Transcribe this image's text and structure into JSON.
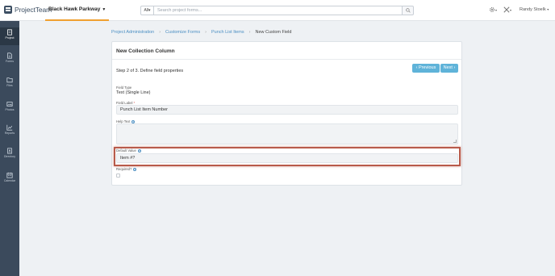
{
  "app": {
    "logo_text": "ProjectTeam",
    "project_name": "Black Hawk Parkway"
  },
  "search": {
    "filter_label": "All",
    "placeholder": "Search project forms..."
  },
  "user": {
    "name": "Randy Stoelk"
  },
  "sidebar": {
    "items": [
      {
        "label": "Project",
        "icon": "building-icon",
        "active": true
      },
      {
        "label": "Forms",
        "icon": "document-icon"
      },
      {
        "label": "Files",
        "icon": "folder-icon"
      },
      {
        "label": "Photos",
        "icon": "image-icon"
      },
      {
        "label": "Reports",
        "icon": "chart-icon"
      },
      {
        "label": "Directory",
        "icon": "contacts-icon"
      },
      {
        "label": "Calendar",
        "icon": "calendar-icon"
      }
    ]
  },
  "breadcrumb": [
    "Project Administration",
    "Customize Forms",
    "Punch List Items",
    "New Custom Field"
  ],
  "card": {
    "title": "New Collection Column",
    "step": "Step 2 of 3. Define field properties",
    "prev_label": "‹ Previous",
    "next_label": "Next ›"
  },
  "fields": {
    "field_type_label": "Field Type",
    "field_type_value": "Text (Single Line)",
    "field_label_label": "Field Label",
    "field_label_value": "Punch List Item Number",
    "help_text_label": "Help Text",
    "default_value_label": "Default Value",
    "default_value": "Item #?",
    "required_label": "Required?"
  },
  "colors": {
    "accent": "#5fb3d9",
    "sidebar": "#3b4a5c",
    "highlight": "#b85a4a",
    "tab_underline": "#f0a030"
  }
}
